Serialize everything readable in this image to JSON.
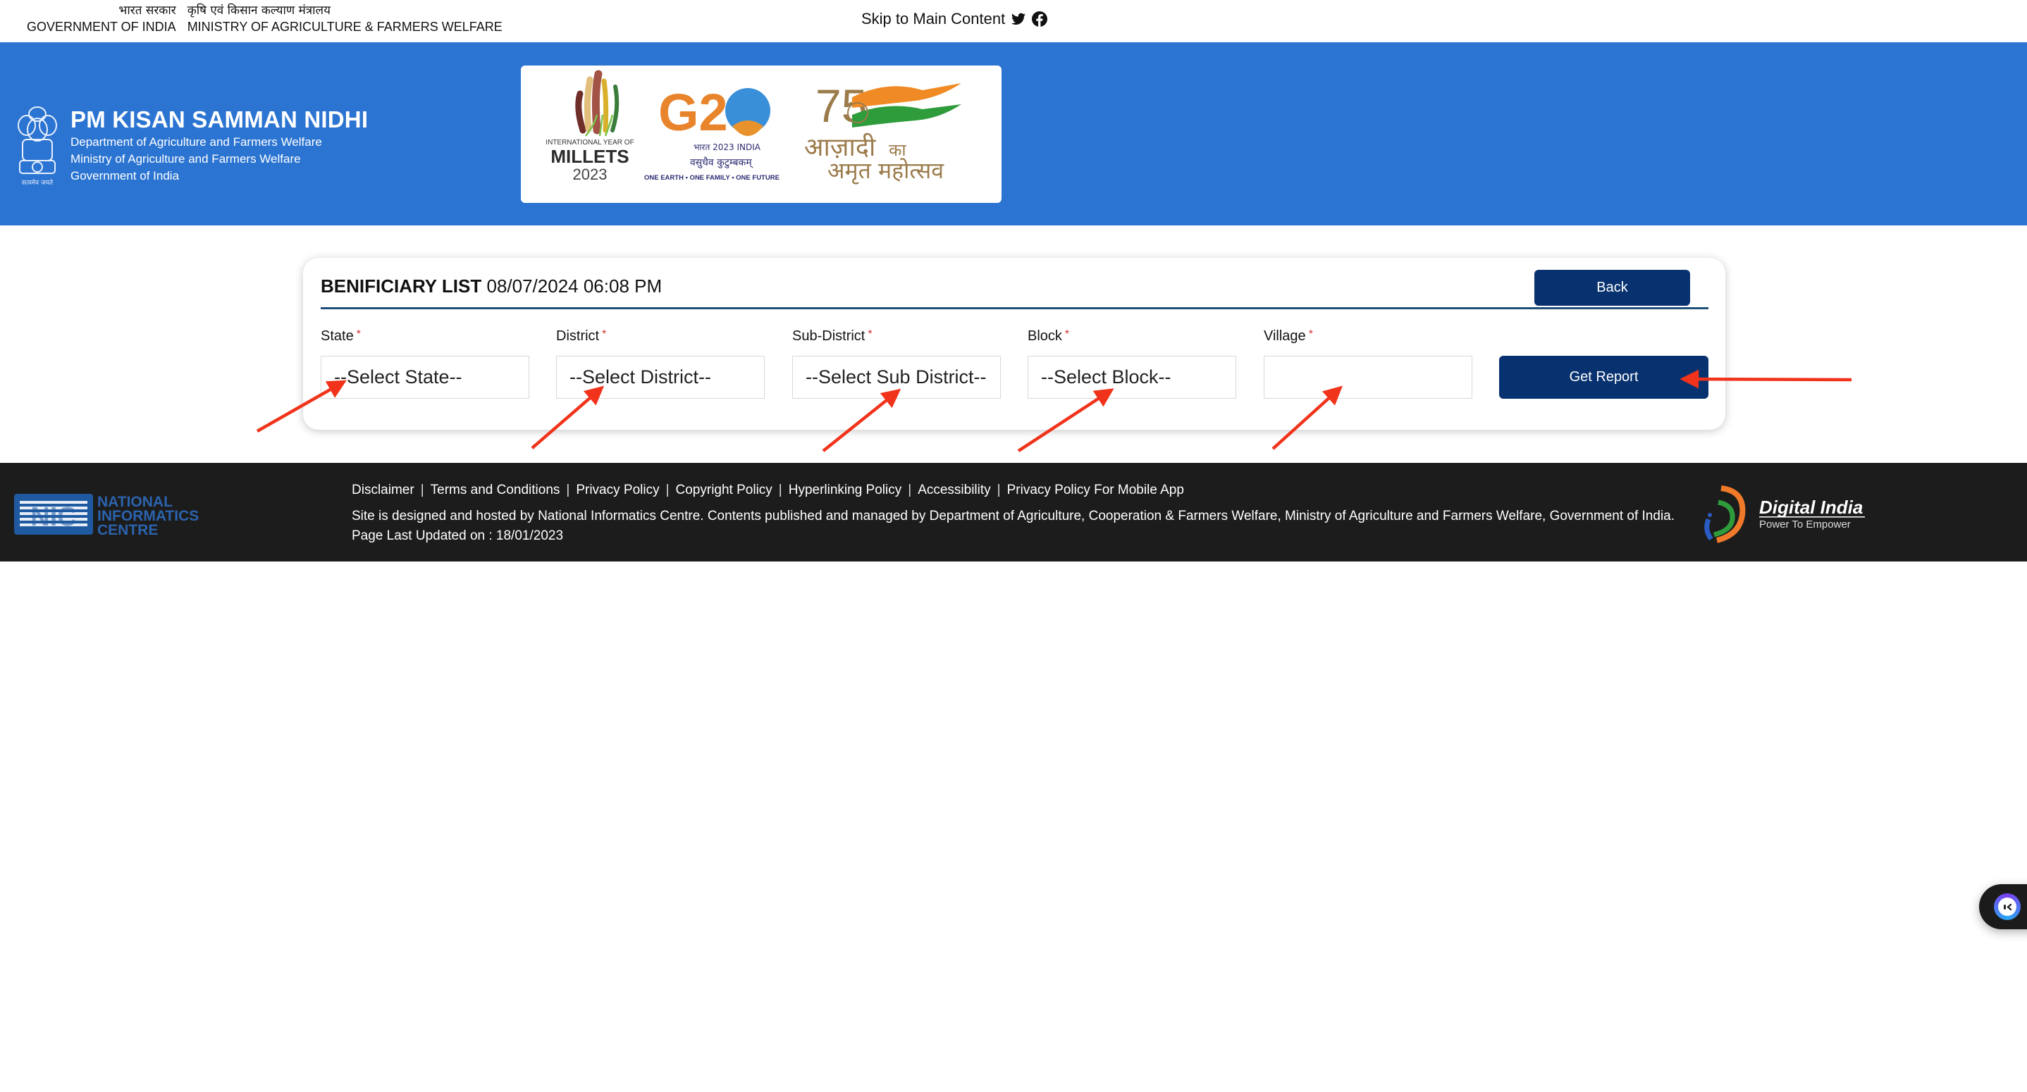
{
  "gov_bar": {
    "left_hindi": "भारत सरकार",
    "left_english": "GOVERNMENT OF INDIA",
    "right_hindi": "कृषि एवं किसान कल्याण मंत्रालय",
    "right_english": "MINISTRY OF AGRICULTURE & FARMERS WELFARE",
    "skip_link": "Skip to Main Content",
    "social_icons": [
      "twitter-icon",
      "facebook-icon"
    ]
  },
  "header": {
    "title": "PM KISAN SAMMAN NIDHI",
    "lines": [
      "Department of Agriculture and Farmers Welfare",
      "Ministry of Agriculture and Farmers Welfare",
      "Government of India"
    ],
    "emblem_caption": "सत्यमेव जयते",
    "banner": {
      "millets": {
        "top": "INTERNATIONAL YEAR OF",
        "main": "MILLETS",
        "year": "2023"
      },
      "g20": {
        "main": "G20",
        "line1": "भारत 2023 INDIA",
        "line2": "वसुधैव कुटुम्बकम्",
        "line3": "ONE EARTH • ONE FAMILY • ONE FUTURE"
      },
      "azadi": {
        "num": "75",
        "line1": "आज़ादी",
        "ka": "का",
        "line2": "अमृत महोत्सव"
      }
    },
    "colors": {
      "blue": "#2b74d1"
    }
  },
  "card": {
    "title_bold": "BENIFICIARY LIST",
    "timestamp": "08/07/2024 06:08 PM",
    "back_label": "Back",
    "fields": [
      {
        "label": "State",
        "required": "*",
        "value": "--Select State--"
      },
      {
        "label": "District",
        "required": "*",
        "value": "--Select District--"
      },
      {
        "label": "Sub-District",
        "required": "*",
        "value": "--Select Sub District--"
      },
      {
        "label": "Block",
        "required": "*",
        "value": "--Select Block--"
      },
      {
        "label": "Village",
        "required": "*",
        "value": ""
      }
    ],
    "get_report_label": "Get Report",
    "colors": {
      "button": "#08326f",
      "rule": "#1f4e79",
      "required": "#d32f2f"
    }
  },
  "footer": {
    "nic": {
      "line1": "NATIONAL",
      "line2": "INFORMATICS",
      "line3": "CENTRE"
    },
    "links": [
      "Disclaimer",
      "Terms and Conditions",
      "Privacy Policy",
      "Copyright Policy",
      "Hyperlinking Policy",
      "Accessibility",
      "Privacy Policy For Mobile App"
    ],
    "hosted_text": "Site is designed and hosted by National Informatics Centre. Contents published and managed by Department of Agriculture, Cooperation & Farmers Welfare, Ministry of Agriculture and Farmers Welfare, Government of India.",
    "last_updated": "Page Last Updated on : 18/01/2023",
    "digital_india": {
      "title": "Digital India",
      "tagline": "Power To Empower"
    }
  },
  "annotations": {
    "arrow_color": "#f0331a",
    "arrow_count": 6
  }
}
